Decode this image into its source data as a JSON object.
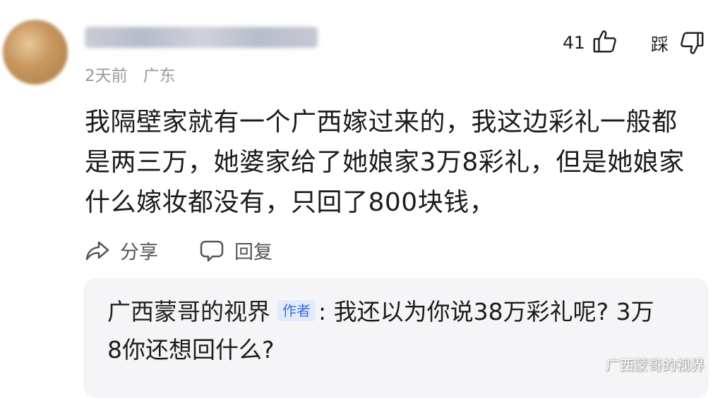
{
  "comment": {
    "meta": {
      "time": "2天前",
      "location": "广东"
    },
    "likes": {
      "count": "41",
      "dislike_label": "踩"
    },
    "text_lines": [
      "我隔壁家就有一个广西嫁过来的，我这边彩礼一般都",
      "是两三万，她婆家给了她娘家3万8彩礼，但是她娘家",
      "什么嫁妆都没有，只回了800块钱，"
    ],
    "actions": {
      "share_label": "分享",
      "reply_label": "回复"
    }
  },
  "reply": {
    "author": "广西蒙哥的视界",
    "badge": "作者",
    "separator": ": ",
    "text_line1": "我还以为你说38万彩礼呢? 3万",
    "text_line2": "8你还想回什么?"
  },
  "watermark": "广西蒙哥的视界",
  "colors": {
    "badge_text": "#3b6fd8",
    "badge_bg": "#e3ebfb",
    "reply_bg": "#f5f5f7",
    "meta": "#9a9a9a"
  }
}
